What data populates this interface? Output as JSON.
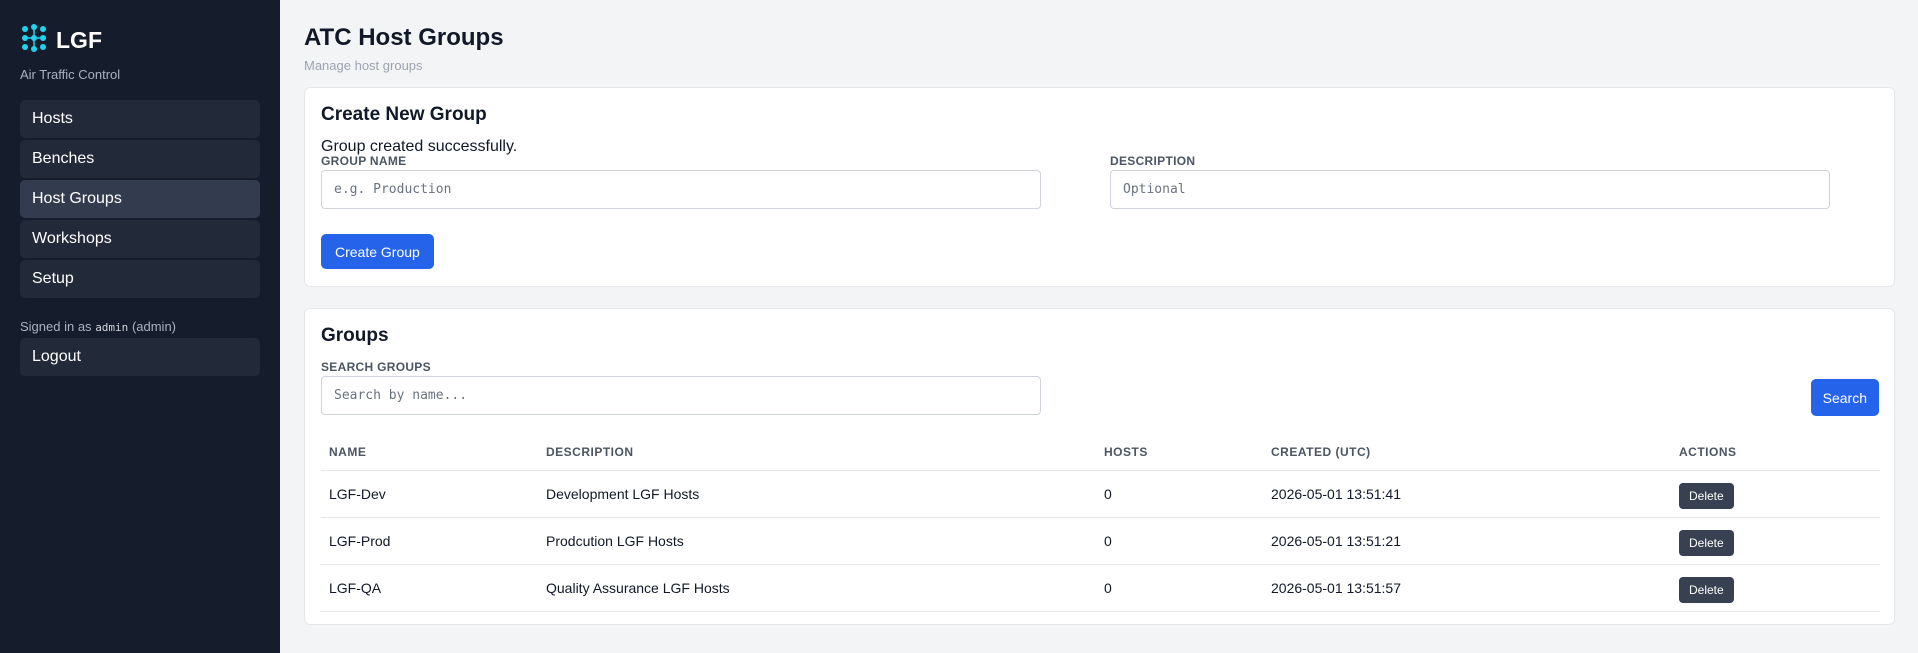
{
  "sidebar": {
    "brand": "LGF",
    "subtitle": "Air Traffic Control",
    "items": [
      {
        "label": "Hosts"
      },
      {
        "label": "Benches"
      },
      {
        "label": "Host Groups"
      },
      {
        "label": "Workshops"
      },
      {
        "label": "Setup"
      }
    ],
    "active": "Host Groups",
    "signed_in_prefix": "Signed in as",
    "username": "admin",
    "role": "(admin)",
    "logout_label": "Logout"
  },
  "header": {
    "title": "ATC Host Groups",
    "subtitle": "Manage host groups"
  },
  "create": {
    "title": "Create New Group",
    "success_message": "Group created successfully.",
    "name_label": "GROUP NAME",
    "name_placeholder": "e.g. Production",
    "name_value": "",
    "description_label": "DESCRIPTION",
    "description_placeholder": "Optional",
    "description_value": "",
    "submit_label": "Create Group"
  },
  "groups": {
    "title": "Groups",
    "search_label": "SEARCH GROUPS",
    "search_placeholder": "Search by name...",
    "search_value": "",
    "search_button": "Search",
    "columns": [
      "NAME",
      "DESCRIPTION",
      "HOSTS",
      "CREATED (UTC)",
      "ACTIONS"
    ],
    "rows": [
      {
        "name": "LGF-Dev",
        "description": "Development LGF Hosts",
        "hosts": "0",
        "created": "2026-05-01 13:51:41",
        "action": "Delete"
      },
      {
        "name": "LGF-Prod",
        "description": "Prodcution LGF Hosts",
        "hosts": "0",
        "created": "2026-05-01 13:51:21",
        "action": "Delete"
      },
      {
        "name": "LGF-QA",
        "description": "Quality Assurance LGF Hosts",
        "hosts": "0",
        "created": "2026-05-01 13:51:57",
        "action": "Delete"
      }
    ]
  },
  "colors": {
    "sidebar_bg": "#151c2c",
    "accent": "#2563eb",
    "logo": "#22d3ee",
    "delete_button": "#374151"
  },
  "icons": {
    "logo": "network-nodes-icon"
  }
}
